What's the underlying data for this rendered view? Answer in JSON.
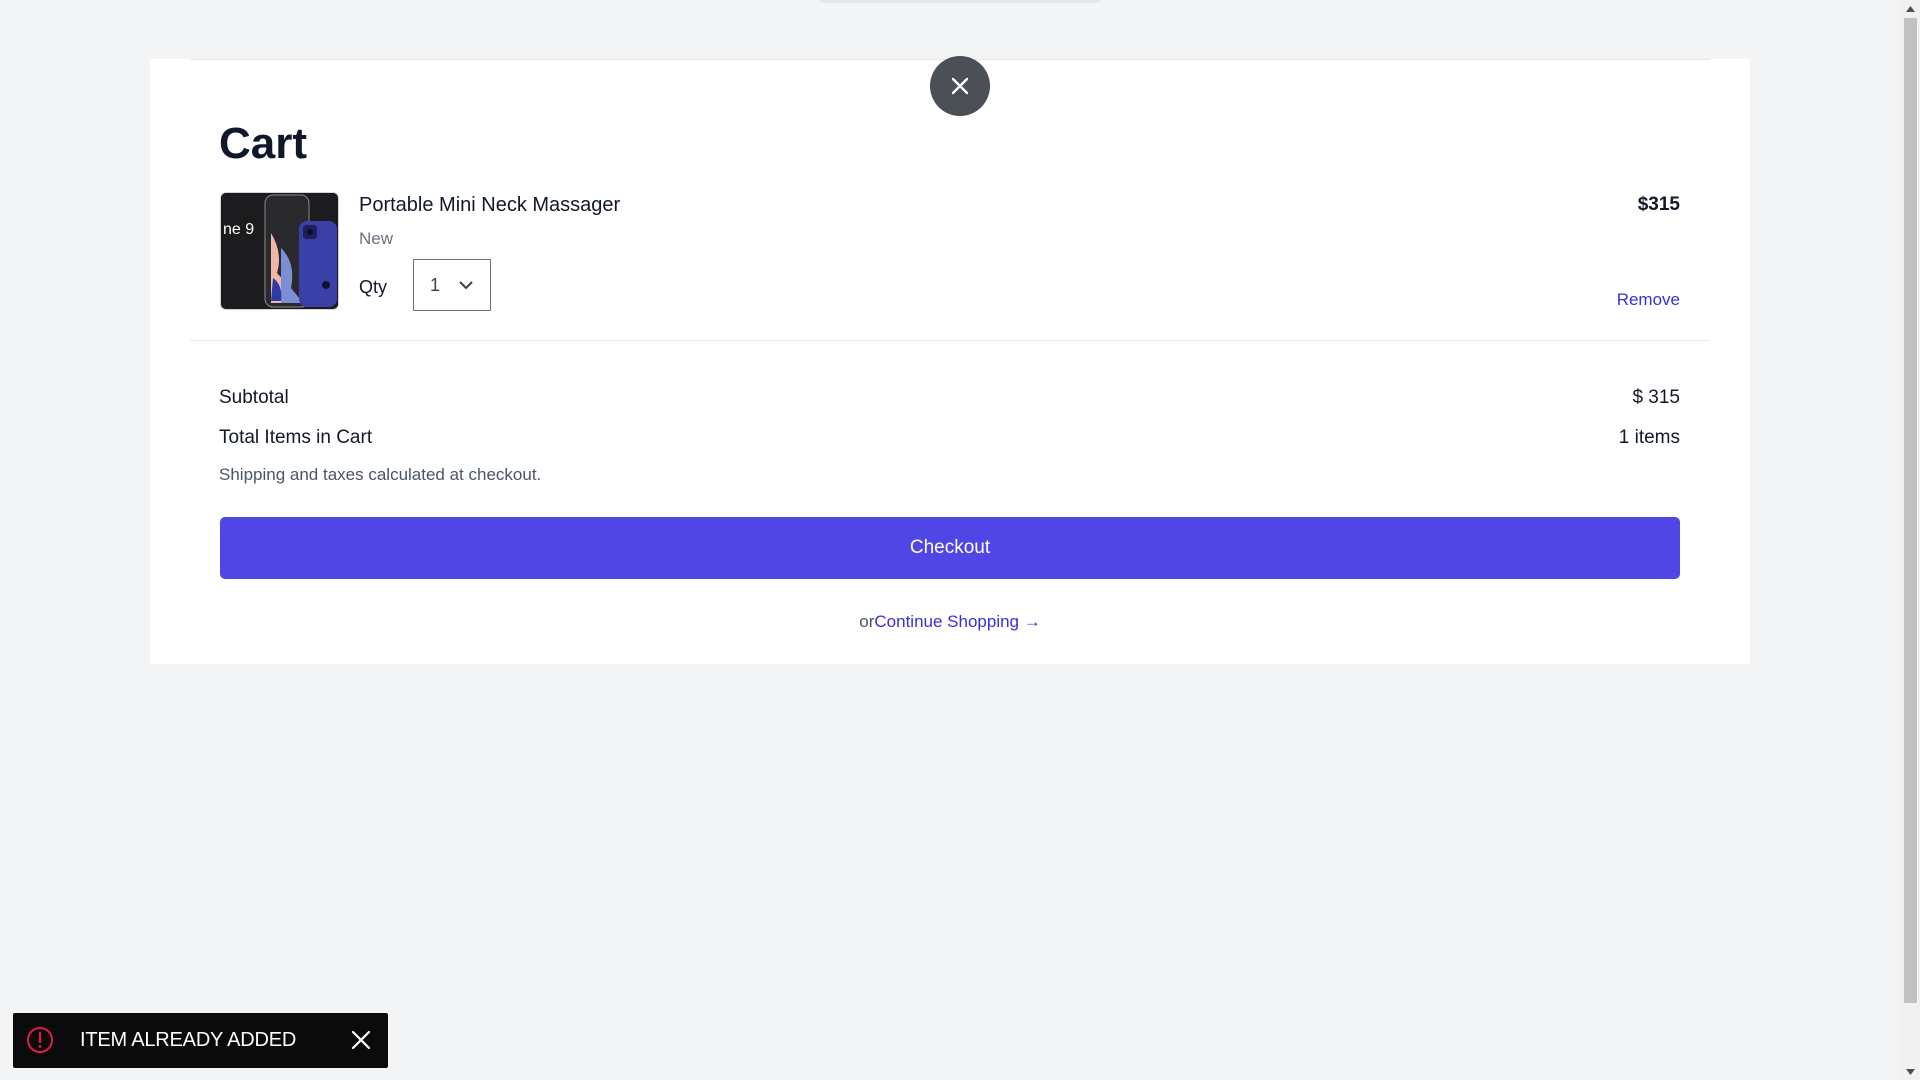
{
  "cart": {
    "title": "Cart",
    "close_icon": "close-icon",
    "items": [
      {
        "name": "Portable Mini Neck Massager",
        "condition": "New",
        "thumb_text": "ne 9",
        "qty_label": "Qty",
        "qty_value": "1",
        "price": "$315",
        "remove_label": "Remove"
      }
    ],
    "summary": {
      "subtotal_label": "Subtotal",
      "subtotal_value": "$ 315",
      "items_label": "Total Items in Cart",
      "items_value": "1 items",
      "shipping_note": "Shipping and taxes calculated at checkout."
    },
    "checkout_label": "Checkout",
    "continue": {
      "prefix": "or",
      "link_label": "Continue Shopping →"
    }
  },
  "toast": {
    "message": "ITEM ALREADY ADDED",
    "icon": "alert-circle-icon",
    "accent_color": "#e11d48"
  },
  "colors": {
    "accent": "#4f46e5",
    "link": "#3b2fd6",
    "page_bg": "#f3f4f6"
  }
}
